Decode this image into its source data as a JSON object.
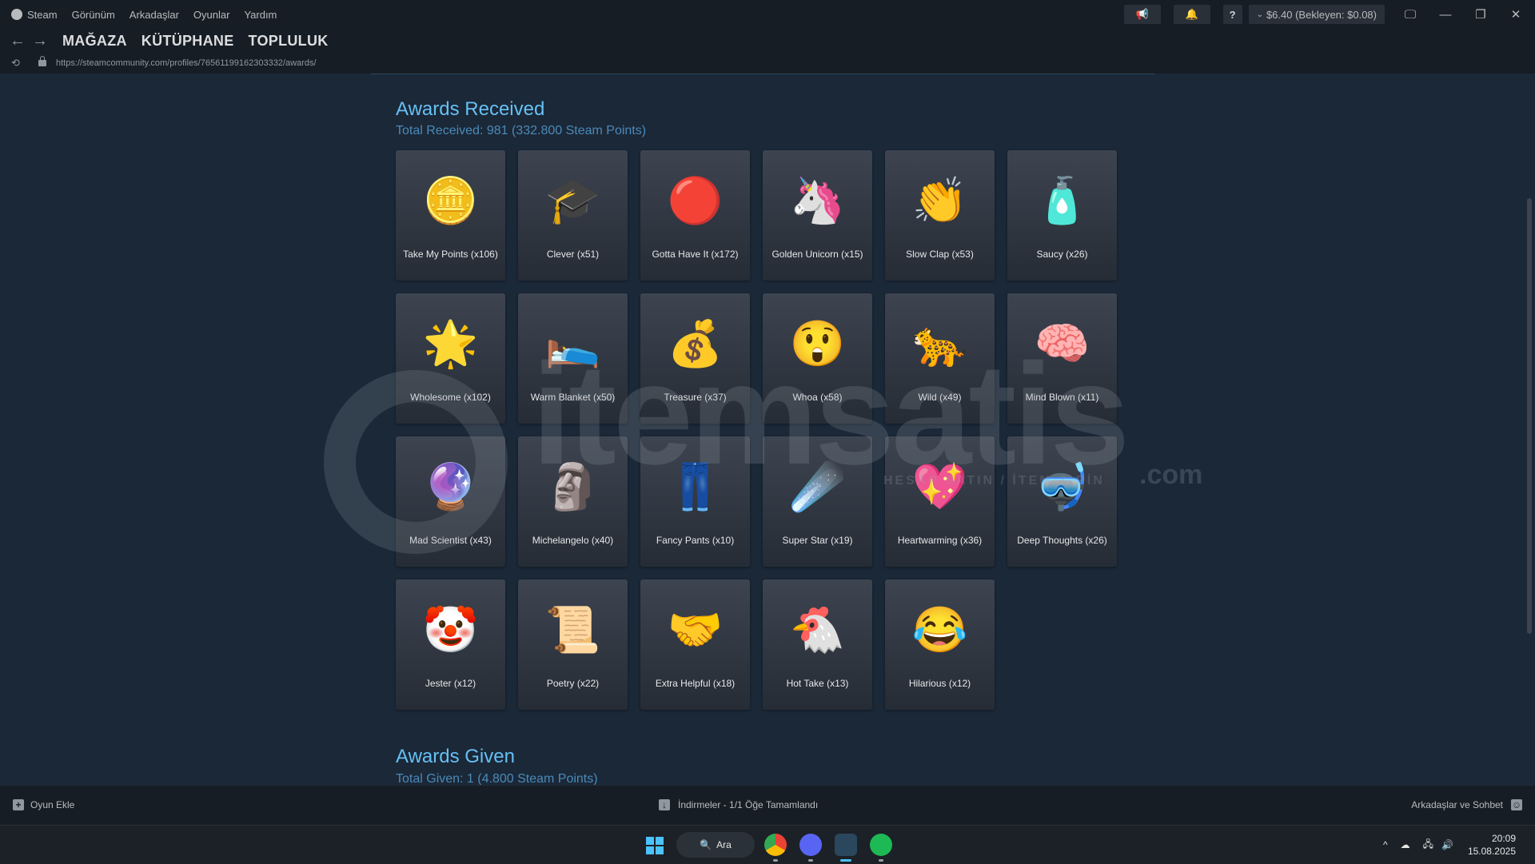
{
  "titlebar": {
    "menu": [
      "Steam",
      "Görünüm",
      "Arkadaşlar",
      "Oyunlar",
      "Yardım"
    ],
    "help": "?",
    "wallet": "$6.40 (Bekleyen: $0.08)"
  },
  "nav": {
    "links": [
      "MAĞAZA",
      "KÜTÜPHANE",
      "TOPLULUK"
    ],
    "url": "https://steamcommunity.com/profiles/76561199162303332/awards/"
  },
  "received": {
    "title": "Awards Received",
    "subtitle": "Total Received: 981 (332.800 Steam Points)",
    "awards": [
      {
        "label": "Take My Points (x106)",
        "icon": "winged-coin-icon",
        "glyph": "🪙"
      },
      {
        "label": "Clever (x51)",
        "icon": "graduation-hotdog-icon",
        "glyph": "🎓"
      },
      {
        "label": "Gotta Have It (x172)",
        "icon": "button-press-icon",
        "glyph": "🔴"
      },
      {
        "label": "Golden Unicorn (x15)",
        "icon": "unicorn-icon",
        "glyph": "🦄"
      },
      {
        "label": "Slow Clap (x53)",
        "icon": "clapping-hands-icon",
        "glyph": "👏"
      },
      {
        "label": "Saucy (x26)",
        "icon": "sauce-bottle-icon",
        "glyph": "🧴"
      },
      {
        "label": "Wholesome (x102)",
        "icon": "glowing-orb-icon",
        "glyph": "🌟"
      },
      {
        "label": "Warm Blanket (x50)",
        "icon": "blanket-icon",
        "glyph": "🛌"
      },
      {
        "label": "Treasure (x37)",
        "icon": "treasure-chest-icon",
        "glyph": "💰"
      },
      {
        "label": "Whoa (x58)",
        "icon": "whoa-face-icon",
        "glyph": "😲"
      },
      {
        "label": "Wild (x49)",
        "icon": "leopard-icon",
        "glyph": "🐆"
      },
      {
        "label": "Mind Blown (x11)",
        "icon": "brain-icon",
        "glyph": "🧠"
      },
      {
        "label": "Mad Scientist (x43)",
        "icon": "plasma-globe-icon",
        "glyph": "🔮"
      },
      {
        "label": "Michelangelo (x40)",
        "icon": "bust-statue-icon",
        "glyph": "🗿"
      },
      {
        "label": "Fancy Pants (x10)",
        "icon": "pants-icon",
        "glyph": "👖"
      },
      {
        "label": "Super Star (x19)",
        "icon": "comet-icon",
        "glyph": "☄️"
      },
      {
        "label": "Heartwarming (x36)",
        "icon": "heart-icon",
        "glyph": "💖"
      },
      {
        "label": "Deep Thoughts (x26)",
        "icon": "diving-brain-icon",
        "glyph": "🤿"
      },
      {
        "label": "Jester (x12)",
        "icon": "clown-face-icon",
        "glyph": "🤡"
      },
      {
        "label": "Poetry (x22)",
        "icon": "scroll-quill-icon",
        "glyph": "📜"
      },
      {
        "label": "Extra Helpful (x18)",
        "icon": "helping-hands-icon",
        "glyph": "🤝"
      },
      {
        "label": "Hot Take (x13)",
        "icon": "fire-chicken-icon",
        "glyph": "🐔"
      },
      {
        "label": "Hilarious (x12)",
        "icon": "laughing-face-icon",
        "glyph": "😂"
      }
    ]
  },
  "given": {
    "title": "Awards Given",
    "subtitle": "Total Given: 1 (4.800 Steam Points)"
  },
  "watermark": {
    "brand": "itemsatis",
    "tagline": "HESAP SATIN / İTEM & PİN",
    "domain": ".com"
  },
  "bottombar": {
    "add_game": "Oyun Ekle",
    "downloads": "İndirmeler - 1/1 Öğe Tamamlandı",
    "friends": "Arkadaşlar ve Sohbet"
  },
  "taskbar": {
    "search": "Ara",
    "time": "20:09",
    "date": "15.08.2025"
  },
  "colors": {
    "accent": "#66c0f4",
    "background": "#1b2838"
  }
}
